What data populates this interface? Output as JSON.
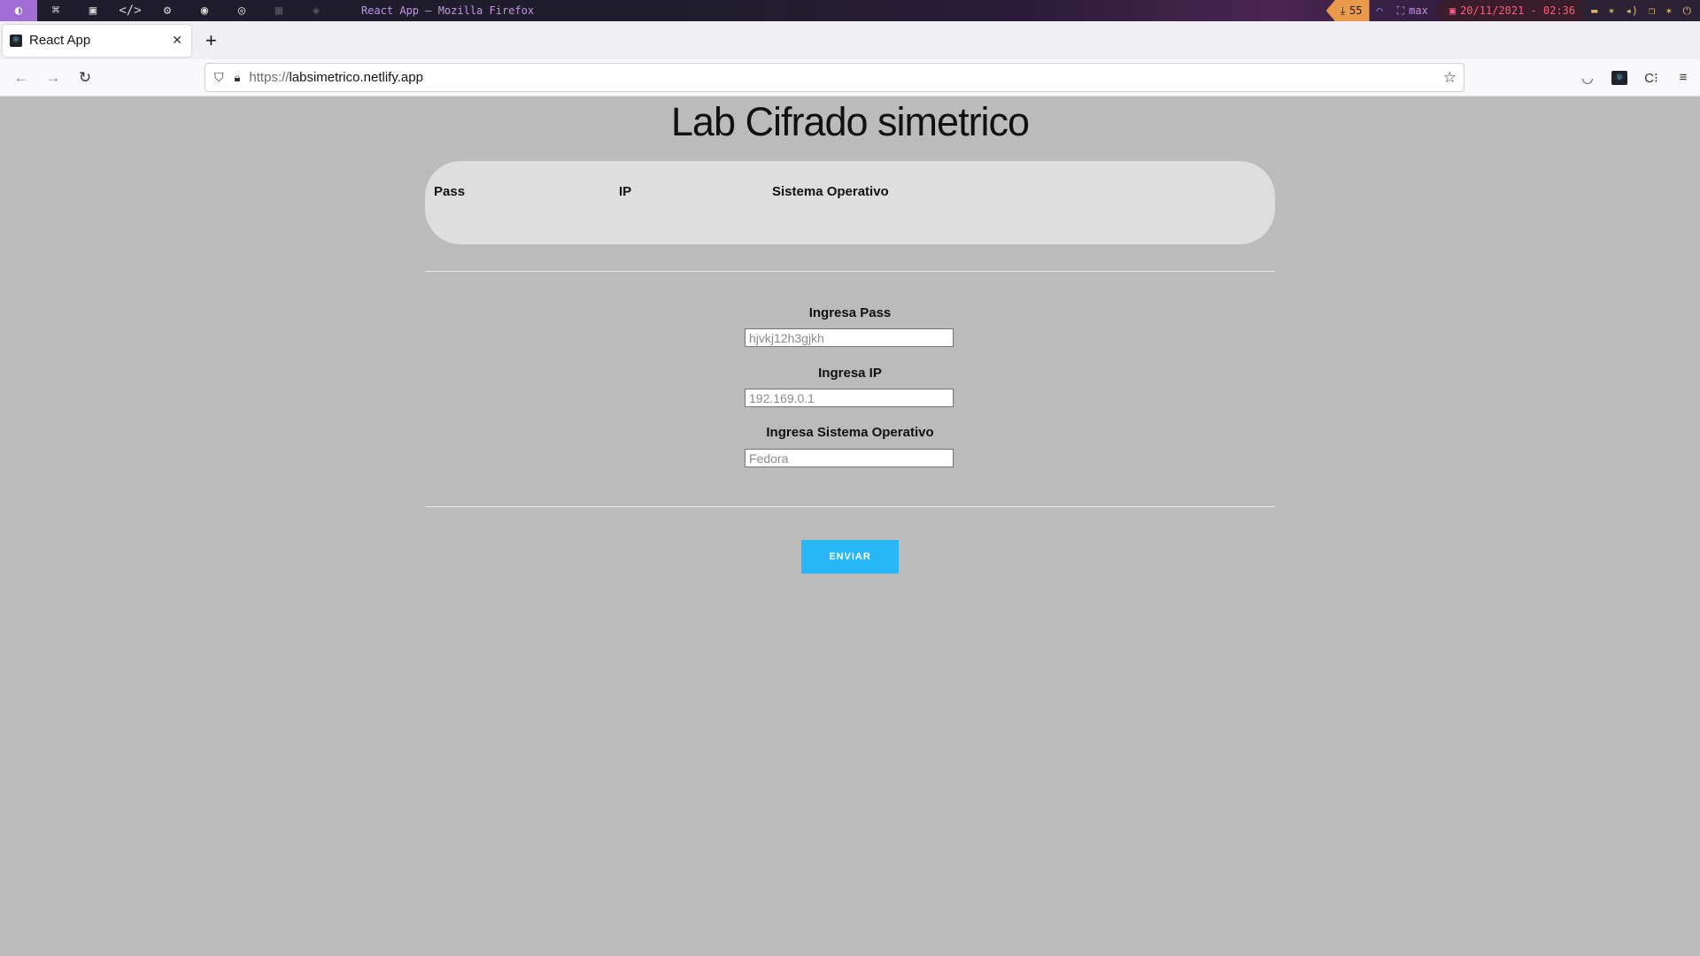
{
  "wm": {
    "workspaces": [
      "firefox-icon",
      "python-icon",
      "terminal-icon",
      "code-icon",
      "settings-icon",
      "github-icon",
      "spotify-icon",
      "image-icon",
      "layers-icon"
    ],
    "window_title": "React App — Mozilla Firefox",
    "downloads": "55",
    "layout": "max",
    "datetime": "20/11/2021 - 02:36"
  },
  "browser": {
    "tab_title": "React App",
    "url_protocol": "https://",
    "url_host": "labsimetrico.netlify.app"
  },
  "page": {
    "title": "Lab Cifrado simetrico",
    "table": {
      "headers": [
        "Pass",
        "IP",
        "Sistema Operativo"
      ]
    },
    "form": {
      "pass_label": "Ingresa Pass",
      "pass_placeholder": "hjvkj12h3gjkh",
      "ip_label": "Ingresa IP",
      "ip_placeholder": "192.169.0.1",
      "os_label": "Ingresa Sistema Operativo",
      "os_placeholder": "Fedora",
      "submit_label": "ENVIAR"
    },
    "colors": {
      "background": "#bbbbbb",
      "card": "#dedede",
      "button": "#29b6f6"
    }
  }
}
